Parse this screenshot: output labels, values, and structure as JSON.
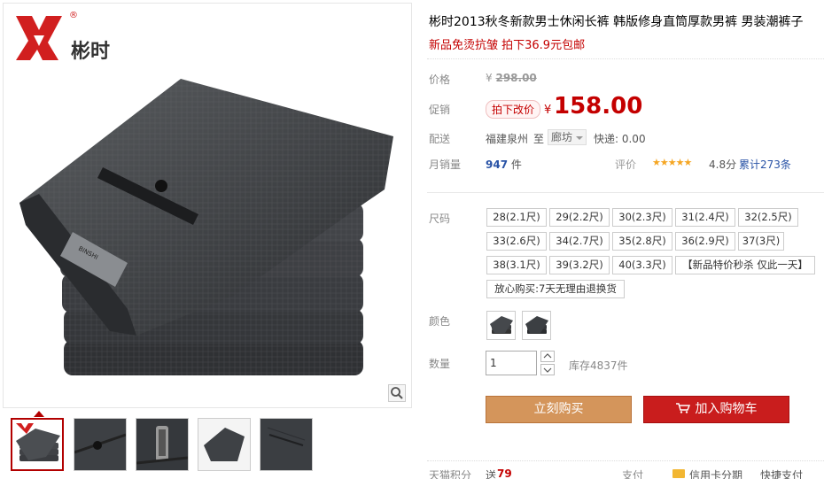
{
  "brand": {
    "name": "彬时",
    "registered_mark": "®"
  },
  "product": {
    "title": "彬时2013秋冬新款男士休闲长裤 韩版修身直筒厚款男裤 男装潮裤子",
    "subtitle": "新品免烫抗皱 拍下36.9元包邮"
  },
  "price": {
    "label": "价格",
    "currency": "¥",
    "original": "298.00"
  },
  "promo": {
    "label": "促销",
    "tag": "拍下改价",
    "currency": "¥",
    "price": "158.00"
  },
  "shipping": {
    "label": "配送",
    "from": "福建泉州",
    "to_label": "至",
    "destination": "廊坊",
    "fee": "快递: 0.00"
  },
  "sales": {
    "label": "月销量",
    "count": "947",
    "unit": "件"
  },
  "rating": {
    "label": "评价",
    "stars": "★★★★★",
    "score": "4.8分",
    "count_text": "累计273条"
  },
  "size": {
    "label": "尺码",
    "options": [
      "28(2.1尺)",
      "29(2.2尺)",
      "30(2.3尺)",
      "31(2.4尺)",
      "32(2.5尺)",
      "33(2.6尺)",
      "34(2.7尺)",
      "35(2.8尺)",
      "36(2.9尺)",
      "37(3尺)",
      "38(3.1尺)",
      "39(3.2尺)",
      "40(3.3尺)",
      "【新品特价秒杀 仅此一天】",
      "放心购买:7天无理由退换货"
    ]
  },
  "color": {
    "label": "颜色",
    "swatches": [
      "dark-grey-folded-trousers",
      "dark-grey-folded-trousers"
    ]
  },
  "quantity": {
    "label": "数量",
    "value": "1",
    "stock": "库存4837件"
  },
  "actions": {
    "buy_now": "立刻购买",
    "add_to_cart": "加入购物车"
  },
  "footer": {
    "points_label": "天猫积分",
    "points_prefix": "送",
    "points_value": "79",
    "pay_label": "支付",
    "installment": "信用卡分期",
    "quick_pay": "快捷支付"
  },
  "colors": {
    "accent_red": "#c40000",
    "buy_orange": "#d4955b",
    "cart_red": "#c91d1d",
    "link_blue": "#2953a6",
    "star_gold": "#f5a623"
  }
}
